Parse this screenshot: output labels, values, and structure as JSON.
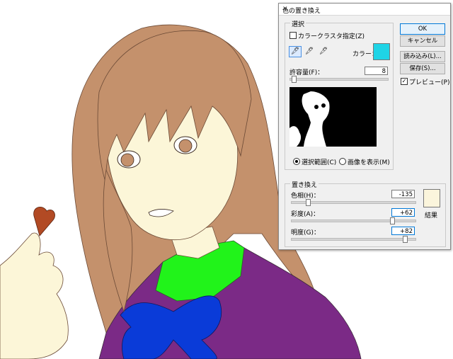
{
  "dialog": {
    "title": "色の置き換え",
    "close_glyph": "✕",
    "selection": {
      "group_label": "選択",
      "color_cluster_label": "カラークラスタ指定(Z)",
      "color_cluster_checked": false,
      "color_label": "カラー：",
      "color_value": "#1fd4e6",
      "fuzziness_label": "許容量(F)：",
      "fuzziness_value": "8",
      "fuzziness_fraction": 0.03,
      "radio_selection_label": "選択範囲(C)",
      "radio_image_label": "画像を表示(M)",
      "selected_view": "selection"
    },
    "replace": {
      "group_label": "置き換え",
      "hue_label": "色相(H)：",
      "hue_value": "-135",
      "hue_fraction": 0.125,
      "saturation_label": "彩度(A)：",
      "saturation_value": "+62",
      "saturation_fraction": 0.81,
      "lightness_label": "明度(G)：",
      "lightness_value": "+82",
      "lightness_fraction": 0.91,
      "result_label": "結果",
      "result_color": "#fbf5dc"
    },
    "buttons": {
      "ok": "OK",
      "cancel": "キャンセル",
      "load": "読み込み(L)...",
      "save": "保存(S)..."
    },
    "preview_label": "プレビュー(P)",
    "preview_checked": true,
    "preview_check_glyph": "✓"
  },
  "colors": {
    "hair": "#c4916c",
    "skin": "#fcf6d8",
    "uniform": "#7b2a86",
    "collar": "#21f31a",
    "bow": "#0a3bd8",
    "chocolate": "#b24a24",
    "accent": "#0078d7"
  }
}
